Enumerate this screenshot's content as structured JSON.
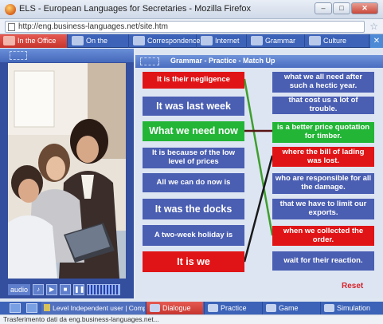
{
  "window": {
    "title": "ELS - European Languages for Secretaries - Mozilla Firefox",
    "minimize": "–",
    "maximize": "□",
    "close": "✕"
  },
  "browser": {
    "url": "http://eng.business-languages.net/site.htm",
    "status": "Trasferimento dati da eng.business-languages.net..."
  },
  "topnav": {
    "tabs": [
      {
        "label": "In the Office",
        "active": true
      },
      {
        "label": "On the telephone",
        "active": false
      },
      {
        "label": "Correspondence",
        "active": false
      },
      {
        "label": "Internet",
        "active": false
      },
      {
        "label": "Grammar",
        "active": false
      },
      {
        "label": "Culture",
        "active": false
      }
    ]
  },
  "media": {
    "audio_label": "audio"
  },
  "exercise": {
    "title": "Grammar - Practice - Match Up",
    "left": [
      {
        "text": "It is their negligence",
        "state": "red"
      },
      {
        "text": "It was last week",
        "state": "blue"
      },
      {
        "text": "What we need now",
        "state": "green"
      },
      {
        "text": "It is because of the low level of prices",
        "state": "blue"
      },
      {
        "text": "All we can do now is",
        "state": "blue"
      },
      {
        "text": "It was the docks",
        "state": "blue"
      },
      {
        "text": "A two-week holiday is",
        "state": "blue"
      },
      {
        "text": "It is we",
        "state": "red"
      }
    ],
    "right": [
      {
        "text": "what we all need after such a hectic year.",
        "state": "blue"
      },
      {
        "text": "that cost us a lot of trouble.",
        "state": "blue"
      },
      {
        "text": "is a better price quotation for timber.",
        "state": "green"
      },
      {
        "text": "where the bill of lading was lost.",
        "state": "red"
      },
      {
        "text": "who are responsible for all the damage.",
        "state": "blue"
      },
      {
        "text": "that we have to limit our exports.",
        "state": "blue"
      },
      {
        "text": "when we collected the order.",
        "state": "red"
      },
      {
        "text": "wait for their reaction.",
        "state": "blue"
      }
    ],
    "reset_label": "Reset"
  },
  "bottombar": {
    "level": "Level Independent user | Complaints",
    "tabs": [
      {
        "label": "Dialogue",
        "active": true
      },
      {
        "label": "Practice",
        "active": false
      },
      {
        "label": "Game",
        "active": false
      },
      {
        "label": "Simulation",
        "active": false
      }
    ]
  },
  "colors": {
    "nav_blue": "#3c63b8",
    "match_red": "#e01416",
    "match_green": "#22b536",
    "box_blue": "#4a5eb2",
    "link_green": "#3f9f2c",
    "link_dark": "#5a1414"
  }
}
